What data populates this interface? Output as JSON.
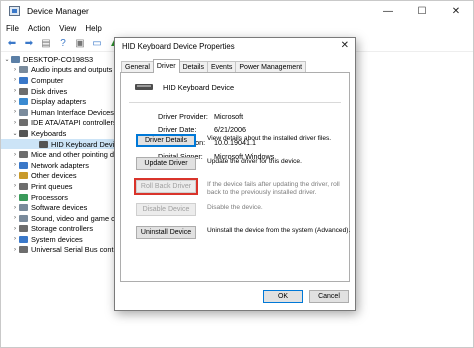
{
  "window": {
    "title": "Device Manager",
    "controls": {
      "minimize": "—",
      "maximize": "☐",
      "close": "✕"
    }
  },
  "menu": [
    "File",
    "Action",
    "View",
    "Help"
  ],
  "toolbar": [
    "back",
    "forward",
    "properties",
    "help",
    "scan",
    "monitor",
    "update",
    "uninstall",
    "download"
  ],
  "tree": [
    {
      "label": "DESKTOP-CO198S3",
      "level": 0,
      "toggle": "⌄",
      "icon_color": "#5b7fa6"
    },
    {
      "label": "Audio inputs and outputs",
      "level": 1,
      "toggle": "›",
      "icon_color": "#7a8b9c"
    },
    {
      "label": "Computer",
      "level": 1,
      "toggle": "›",
      "icon_color": "#3a78c9"
    },
    {
      "label": "Disk drives",
      "level": 1,
      "toggle": "›",
      "icon_color": "#6d6d6d"
    },
    {
      "label": "Display adapters",
      "level": 1,
      "toggle": "›",
      "icon_color": "#3a8ad1"
    },
    {
      "label": "Human Interface Devices",
      "level": 1,
      "toggle": "›",
      "icon_color": "#7a8b9c"
    },
    {
      "label": "IDE ATA/ATAPI controllers",
      "level": 1,
      "toggle": "›",
      "icon_color": "#6d6d6d"
    },
    {
      "label": "Keyboards",
      "level": 1,
      "toggle": "⌄",
      "icon_color": "#555555"
    },
    {
      "label": "HID Keyboard Device",
      "level": 2,
      "toggle": "",
      "icon_color": "#555555",
      "selected": true
    },
    {
      "label": "Mice and other pointing devices",
      "level": 1,
      "toggle": "›",
      "icon_color": "#6d6d6d"
    },
    {
      "label": "Network adapters",
      "level": 1,
      "toggle": "›",
      "icon_color": "#3a78c9"
    },
    {
      "label": "Other devices",
      "level": 1,
      "toggle": "›",
      "icon_color": "#c99a2a"
    },
    {
      "label": "Print queues",
      "level": 1,
      "toggle": "›",
      "icon_color": "#6d6d6d"
    },
    {
      "label": "Processors",
      "level": 1,
      "toggle": "›",
      "icon_color": "#3a9a5a"
    },
    {
      "label": "Software devices",
      "level": 1,
      "toggle": "›",
      "icon_color": "#7a8b9c"
    },
    {
      "label": "Sound, video and game controllers",
      "level": 1,
      "toggle": "›",
      "icon_color": "#7a8b9c"
    },
    {
      "label": "Storage controllers",
      "level": 1,
      "toggle": "›",
      "icon_color": "#6d6d6d"
    },
    {
      "label": "System devices",
      "level": 1,
      "toggle": "›",
      "icon_color": "#3a78c9"
    },
    {
      "label": "Universal Serial Bus controllers",
      "level": 1,
      "toggle": "›",
      "icon_color": "#6d6d6d"
    }
  ],
  "dialog": {
    "title": "HID Keyboard Device Properties",
    "close": "✕",
    "tabs": [
      "General",
      "Driver",
      "Details",
      "Events",
      "Power Management"
    ],
    "active_tab": "Driver",
    "device_name": "HID Keyboard Device",
    "info": [
      {
        "key": "Driver Provider:",
        "value": "Microsoft"
      },
      {
        "key": "Driver Date:",
        "value": "6/21/2006"
      },
      {
        "key": "Driver Version:",
        "value": "10.0.19041.1"
      },
      {
        "key": "Digital Signer:",
        "value": "Microsoft Windows"
      }
    ],
    "actions": [
      {
        "label": "Driver Details",
        "u": "D",
        "desc": "View details about the installed driver files.",
        "state": "focus"
      },
      {
        "label": "Update Driver",
        "u": "p",
        "desc": "Update the driver for this device.",
        "state": "normal"
      },
      {
        "label": "Roll Back Driver",
        "u": "R",
        "desc": "If the device fails after updating the driver, roll back to the previously installed driver.",
        "state": "disabled-highlight"
      },
      {
        "label": "Disable Device",
        "u": "D",
        "desc": "Disable the device.",
        "state": "disabled"
      },
      {
        "label": "Uninstall Device",
        "u": "U",
        "desc": "Uninstall the device from the system (Advanced).",
        "state": "normal"
      }
    ],
    "ok": "OK",
    "cancel": "Cancel"
  },
  "accent_color": "#0078d7",
  "highlight_color": "#d9342b"
}
